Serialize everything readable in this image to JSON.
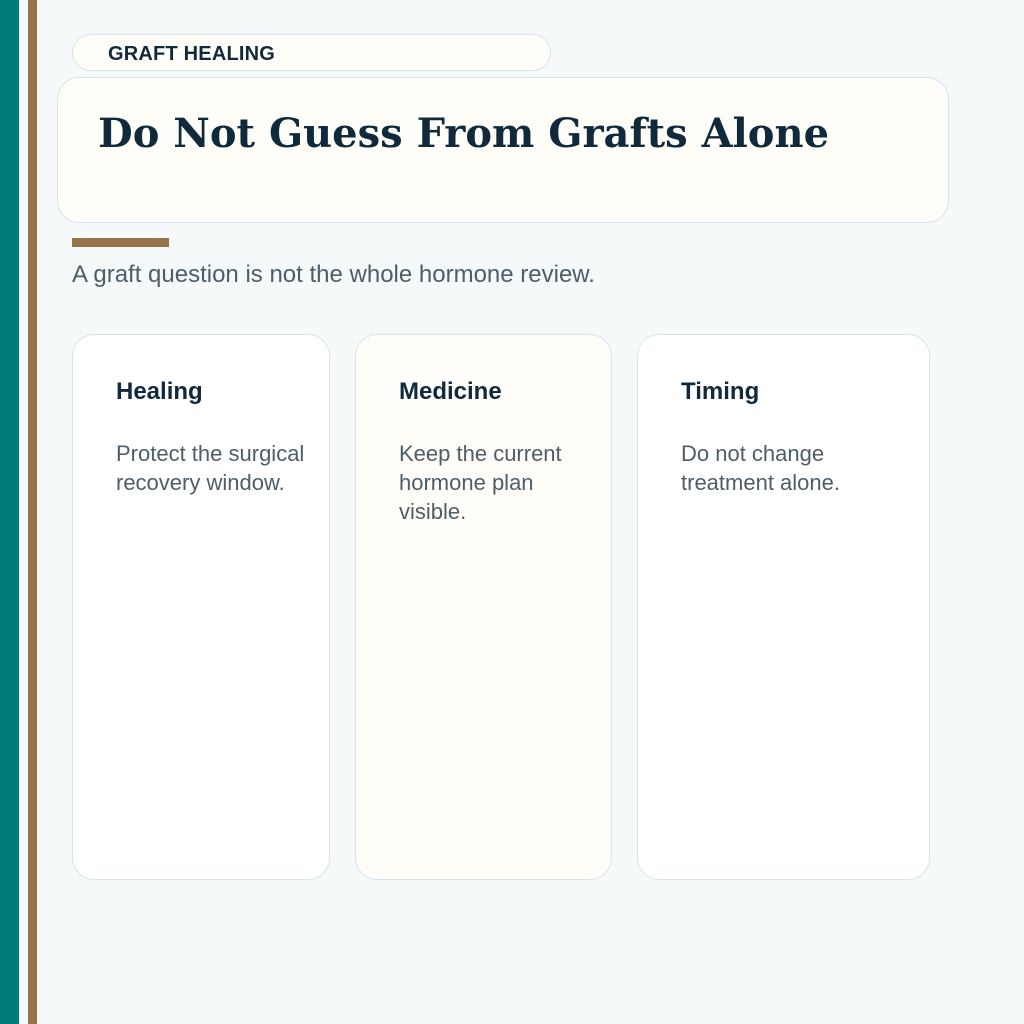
{
  "colors": {
    "teal_stripe": "#007a7a",
    "gold_accent": "#96744b",
    "navy_text": "#102a3b",
    "gray_text": "#4d5e69",
    "card_border": "#d6e4e8",
    "cream_fill": "#fefdf8",
    "page_background": "#f5f9fa"
  },
  "header": {
    "section_label": "GRAFT HEALING",
    "title": "Do Not Guess From Grafts Alone",
    "subtitle": "A graft question is not the whole hormone review."
  },
  "cards": [
    {
      "heading": "Healing",
      "body": "Protect the surgical recovery window."
    },
    {
      "heading": "Medicine",
      "body": "Keep the current hormone plan visible."
    },
    {
      "heading": "Timing",
      "body": "Do not change treatment alone."
    }
  ]
}
